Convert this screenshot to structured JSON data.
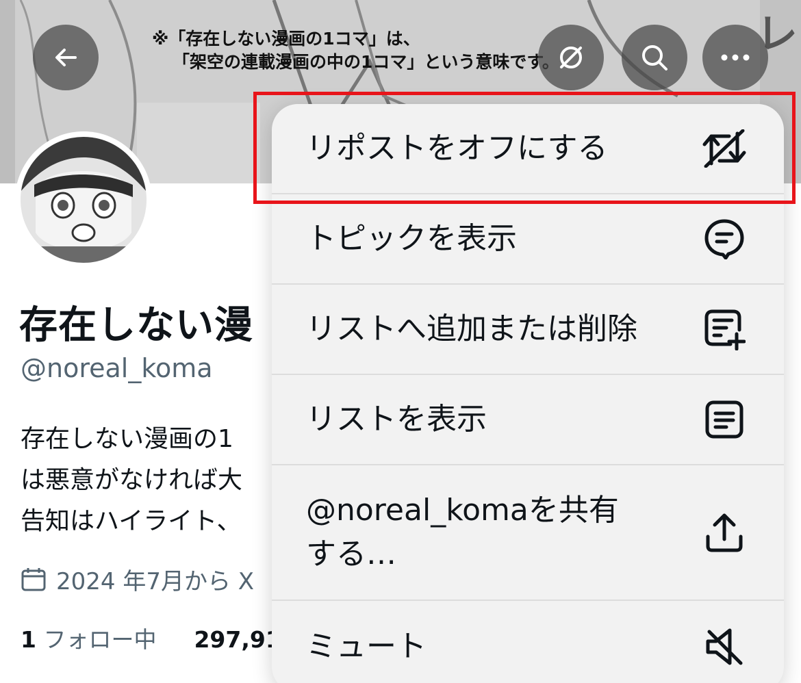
{
  "banner": {
    "caption_line1": "※「存在しない漫画の1コマ」は、",
    "caption_line2": "「架空の連載漫画の中の1コマ」という意味です。"
  },
  "top_bar": {
    "back_icon": "arrow-left-icon",
    "repost_icon": "repost-off-icon",
    "search_icon": "search-icon",
    "more_icon": "more-horizontal-icon"
  },
  "profile": {
    "name": "存在しない漫",
    "handle": "@noreal_koma",
    "bio_lines": [
      "存在しない漫画の1",
      "は悪意がなければ大",
      "告知はハイライト、"
    ],
    "joined": "2024 年7月から X",
    "following_count": "1",
    "following_label": "フォロー中",
    "followers_count": "297,91"
  },
  "menu": {
    "items": [
      {
        "label": "リポストをオフにする",
        "icon": "repost-off-icon"
      },
      {
        "label": "トピックを表示",
        "icon": "topic-bubble-icon"
      },
      {
        "label": "リストへ追加または削除",
        "icon": "list-add-icon"
      },
      {
        "label": "リストを表示",
        "icon": "list-icon"
      },
      {
        "label_line1": "@noreal_komaを共有",
        "label_line2": "する…",
        "icon": "share-icon"
      },
      {
        "label": "ミュート",
        "icon": "mute-icon"
      }
    ]
  },
  "colors": {
    "highlight": "#e8141a",
    "menu_bg": "#f2f2f2",
    "text": "#0f1419",
    "secondary_text": "#536471"
  }
}
